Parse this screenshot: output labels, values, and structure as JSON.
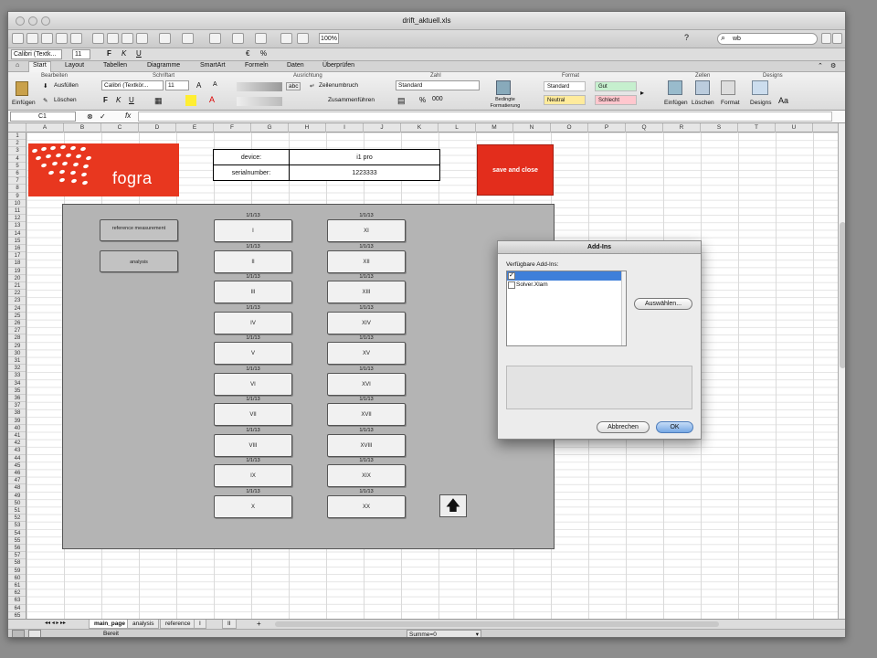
{
  "window": {
    "title": "drift_aktuell.xls"
  },
  "toolbar": {
    "zoom": "100%",
    "search": "wb"
  },
  "format_bar": {
    "font": "Calibri (Textk...",
    "size": "11"
  },
  "ribbon_tabs": [
    "Start",
    "Layout",
    "Tabellen",
    "Diagramme",
    "SmartArt",
    "Formeln",
    "Daten",
    "Überprüfen"
  ],
  "ribbon": {
    "groups": [
      "Bearbeiten",
      "Schriftart",
      "Ausrichtung",
      "Zahl",
      "Format",
      "Zellen",
      "Designs"
    ],
    "fill_label": "Ausfüllen",
    "clear_label": "Löschen",
    "paste_label": "Einfügen",
    "font": "Calibri (Textkör...",
    "size": "11",
    "wrap_label": "Zeilenumbruch",
    "abc": "abc",
    "merge_label": "Zusammenführen",
    "number_format": "Standard",
    "percent": "%",
    "thousands": "000",
    "cond_format": "Bedingte Formatierung",
    "styles": [
      {
        "label": "Standard",
        "bg": "#ffffff"
      },
      {
        "label": "Gut",
        "bg": "#c6efce"
      },
      {
        "label": "Neutral",
        "bg": "#ffeb9c"
      },
      {
        "label": "Schlecht",
        "bg": "#ffc7ce"
      }
    ],
    "insert_cells": "Einfügen",
    "delete_cells": "Löschen",
    "format_cells": "Format",
    "designs": "Designs",
    "aa": "Aa"
  },
  "formula_bar": {
    "cell_ref": "C1",
    "fx": "fx"
  },
  "columns": [
    "A",
    "B",
    "C",
    "D",
    "E",
    "F",
    "G",
    "H",
    "I",
    "J",
    "K",
    "L",
    "M",
    "N",
    "O",
    "P",
    "Q",
    "R",
    "S",
    "T",
    "U"
  ],
  "sheet": {
    "logo_text": "fogra",
    "device_label": "device:",
    "device_value": "i1 pro",
    "serial_label": "serialnumber:",
    "serial_value": "1223333",
    "save_button": "save and close",
    "reference_button": "reference measurement",
    "analysis_button": "analysis",
    "left_buttons": [
      "I",
      "II",
      "III",
      "IV",
      "V",
      "VI",
      "VII",
      "VIII",
      "IX",
      "X"
    ],
    "right_buttons": [
      "XI",
      "XII",
      "XIII",
      "XIV",
      "XV",
      "XVI",
      "XVII",
      "XVIII",
      "XIX",
      "XX"
    ],
    "date_label": "1/1/13",
    "up_arrow": "🡅"
  },
  "sheet_tabs": [
    "main_page",
    "analysis",
    "reference",
    "I",
    "II"
  ],
  "status": {
    "ready": "Bereit",
    "sum": "Summe=0"
  },
  "dialog": {
    "title": "Add-Ins",
    "list_label": "Verfügbare Add-Ins:",
    "items": [
      {
        "label": "",
        "checked": true
      },
      {
        "label": "Solver.Xlam",
        "checked": false
      }
    ],
    "select_button": "Auswählen...",
    "cancel_button": "Abbrechen",
    "ok_button": "OK"
  }
}
